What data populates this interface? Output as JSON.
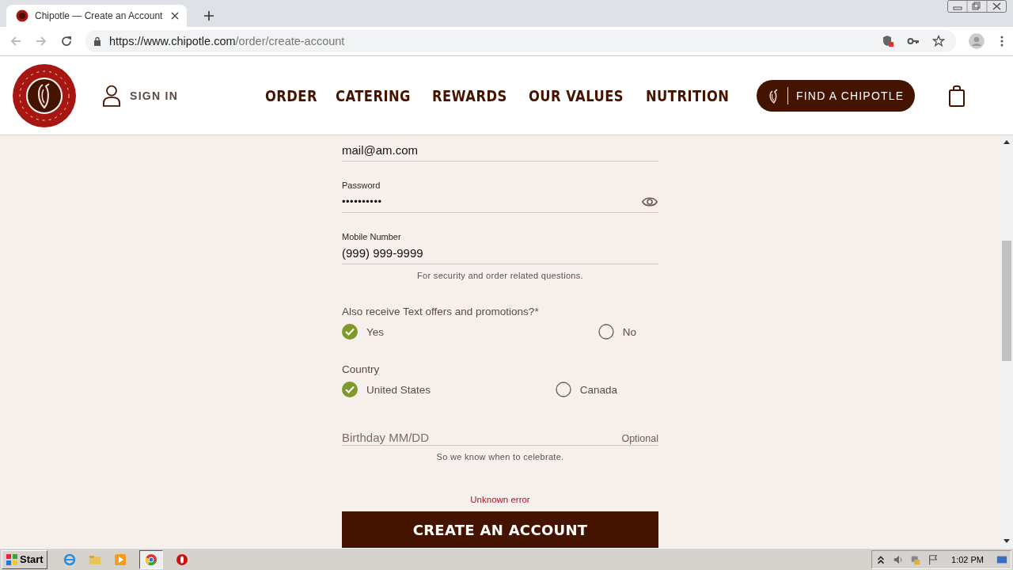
{
  "browser": {
    "tab_title": "Chipotle — Create an Account",
    "url_host": "https://www.chipotle.com",
    "url_path": "/order/create-account"
  },
  "header": {
    "sign_in": "SIGN IN",
    "nav": [
      "ORDER",
      "CATERING",
      "REWARDS",
      "OUR VALUES",
      "NUTRITION"
    ],
    "find_button": "FIND A CHIPOTLE"
  },
  "form": {
    "email": {
      "value": "mail@am.com"
    },
    "password": {
      "label": "Password",
      "value": "••••••••••"
    },
    "mobile": {
      "label": "Mobile Number",
      "value": "(999) 999-9999",
      "hint": "For security and order related questions."
    },
    "radio_groups": [
      {
        "label": "Also receive Text offers and promotions?*",
        "options": [
          {
            "label": "Yes",
            "selected": true
          },
          {
            "label": "No",
            "selected": false
          }
        ]
      },
      {
        "label": "Country",
        "options": [
          {
            "label": "United States",
            "selected": true
          },
          {
            "label": "Canada",
            "selected": false
          }
        ]
      }
    ],
    "birthday": {
      "placeholder": "Birthday MM/DD",
      "optional": "Optional",
      "hint": "So we know when to celebrate."
    },
    "error": "Unknown error",
    "submit": "CREATE AN ACCOUNT"
  },
  "taskbar": {
    "start": "Start",
    "clock": "1:02 PM"
  }
}
